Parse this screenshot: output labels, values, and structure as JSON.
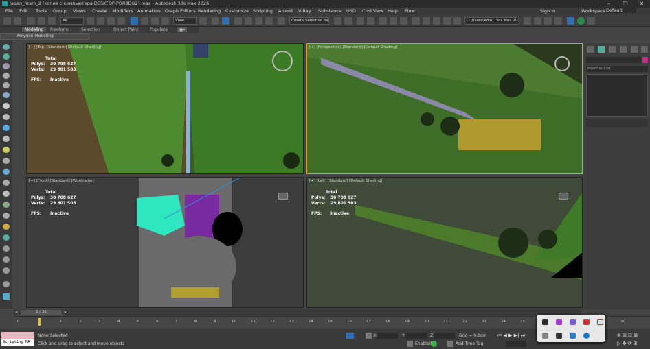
{
  "window": {
    "title": "Japan_hram_2 [копия с компьютера DESKTOP-PGR8DG2].max - Autodesk 3ds Max 2026",
    "controls": [
      "–",
      "❐",
      "✕"
    ]
  },
  "menu": [
    "File",
    "Edit",
    "Tools",
    "Group",
    "Views",
    "Create",
    "Modifiers",
    "Animation",
    "Graph Editors",
    "Rendering",
    "Customize",
    "Scripting",
    "Arnold",
    "V-Ray",
    "Substance",
    "USD",
    "Civil View",
    "Help",
    "Flow"
  ],
  "account": {
    "sign_in": "Sign In",
    "workspaces_label": "Workspaces:",
    "workspace_value": "Default"
  },
  "toolbar": {
    "selection_filter": "All",
    "ref_coord": "View",
    "named_selection": "Create Selection Se",
    "project_path": "C:\\Users\\Adm...3ds Max 2026"
  },
  "ribbon": {
    "tabs": [
      "Modeling",
      "Freeform",
      "Selection",
      "Object Paint",
      "Populate"
    ],
    "subtitle": "Polygon Modeling"
  },
  "viewports": [
    {
      "label": "[+] [Top] [Standard] [Default Shading]",
      "total": "Total",
      "polys_label": "Polys:",
      "polys": "30 708 627",
      "verts_label": "Verts:",
      "verts": "29 801 503",
      "fps_label": "FPS:",
      "fps": "Inactive"
    },
    {
      "label": "[+] [Perspective] [Standard] [Default Shading]"
    },
    {
      "label": "[+] [Front] [Standard] [Wireframe]",
      "total": "Total",
      "polys_label": "Polys:",
      "polys": "30 708 627",
      "verts_label": "Verts:",
      "verts": "29 801 503",
      "fps_label": "FPS:",
      "fps": "Inactive"
    },
    {
      "label": "[+] [Left] [Standard] [Default Shading]",
      "total": "Total",
      "polys_label": "Polys:",
      "polys": "30 708 627",
      "verts_label": "Verts:",
      "verts": "29 801 503",
      "fps_label": "FPS:",
      "fps": "Inactive"
    }
  ],
  "command_panel": {
    "modifier_list": "Modifier List"
  },
  "timeline": {
    "frame_counter": "0 / 30",
    "ticks": [
      "0",
      "1",
      "2",
      "3",
      "4",
      "5",
      "6",
      "7",
      "8",
      "9",
      "10",
      "11",
      "12",
      "13",
      "14",
      "15",
      "16",
      "17",
      "18",
      "19",
      "20",
      "21",
      "22",
      "23",
      "24",
      "25",
      "30"
    ]
  },
  "status": {
    "script_label": "Scripting MA",
    "selection": "None Selected",
    "hint": "Click and drag to select and move objects",
    "x_label": "X:",
    "y_label": "Y:",
    "z_label": "Z:",
    "grid": "Grid = 0,0cm",
    "enabled_label": "Enabled:",
    "add_time_tag": "Add Time Tag"
  },
  "colors": {
    "accent": "#2f6fb0",
    "selected_green": "#2ee6c0",
    "viewport_bg": "#3c3c3c"
  }
}
